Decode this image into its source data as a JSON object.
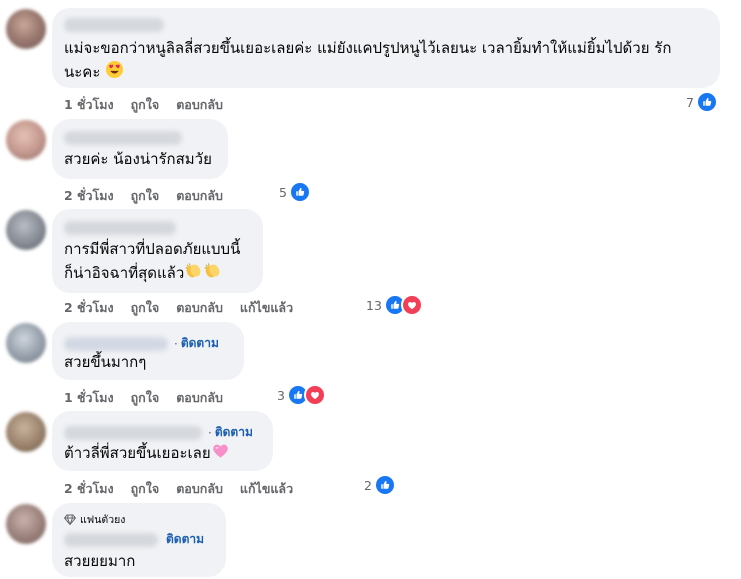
{
  "comments": [
    {
      "text_lines": [
        "แม่จะขอกว่าหนูลิลลี่สวยขึ้นเยอะเลยค่ะ แม่ยังแคปรูปหนูไว้เลยนะ เวลายิ้มทำให้แม่ยิ้มไปด้วย รัก",
        "นะคะ"
      ],
      "emoji": "heart-eyes",
      "time": "1 ชั่วโมง",
      "like": "ถูกใจ",
      "reply": "ตอบกลับ",
      "reaction_count": "7",
      "reactions": [
        "like"
      ]
    },
    {
      "text_lines": [
        "สวยค่ะ น้องน่ารักสมวัย"
      ],
      "time": "2 ชั่วโมง",
      "like": "ถูกใจ",
      "reply": "ตอบกลับ",
      "reaction_count": "5",
      "reactions": [
        "like"
      ]
    },
    {
      "text_lines": [
        "การมีพี่สาวที่ปลอดภัยแบบนี้",
        "ก็น่าอิจฉาที่สุดแล้ว"
      ],
      "emoji": "clapping-hands",
      "time": "2 ชั่วโมง",
      "like": "ถูกใจ",
      "reply": "ตอบกลับ",
      "edited": "แก้ไขแล้ว",
      "reaction_count": "13",
      "reactions": [
        "like",
        "love"
      ]
    },
    {
      "follow": "ติดตาม",
      "text_lines": [
        "สวยขึ้นมากๆ"
      ],
      "time": "1 ชั่วโมง",
      "like": "ถูกใจ",
      "reply": "ตอบกลับ",
      "reaction_count": "3",
      "reactions": [
        "like",
        "love"
      ]
    },
    {
      "follow": "ติดตาม",
      "text_lines": [
        "ต้าวลี่พี่สวยขึ้นเยอะเลย"
      ],
      "emoji": "pink-heart",
      "time": "2 ชั่วโมง",
      "like": "ถูกใจ",
      "reply": "ตอบกลับ",
      "edited": "แก้ไขแล้ว",
      "reaction_count": "2",
      "reactions": [
        "like"
      ]
    },
    {
      "badge": "แฟนตัวยง",
      "follow": "ติดตาม",
      "text_lines": [
        "สวยยยมาก"
      ]
    }
  ],
  "colors": {
    "bubble": "#f0f2f5",
    "meta": "#65676b",
    "follow": "#1b5fb0",
    "like_blue": "#1877f2",
    "love_red": "#f33e58"
  }
}
